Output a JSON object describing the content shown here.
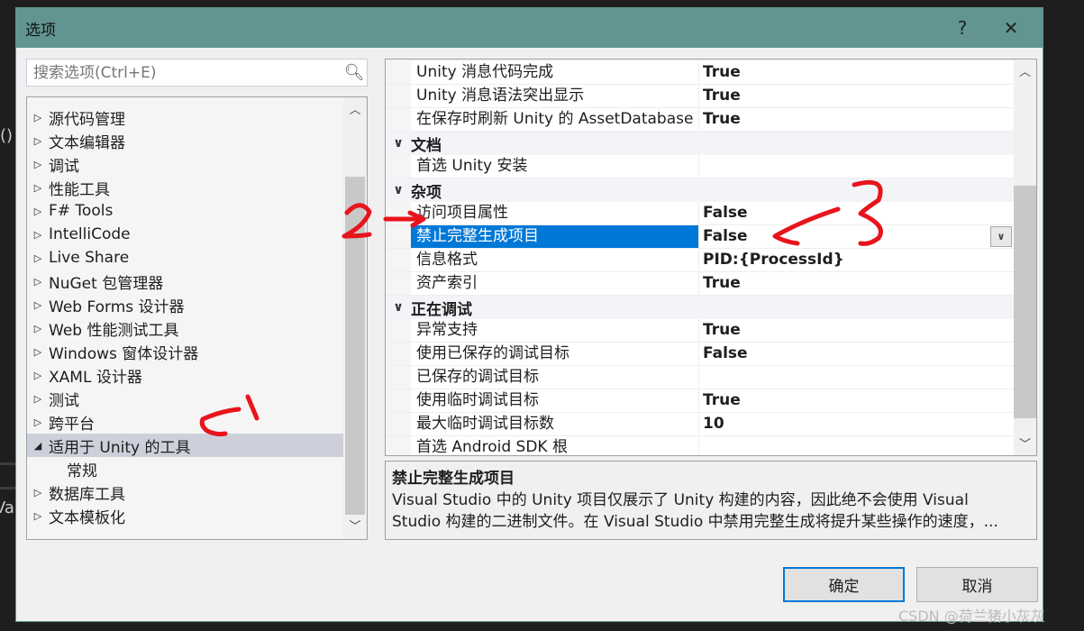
{
  "background_code": {
    "line1": "()",
    "line2": "Va"
  },
  "dialog": {
    "title": "选项",
    "help": "?",
    "close": "✕"
  },
  "search": {
    "placeholder": "搜索选项(Ctrl+E)"
  },
  "tree": {
    "items": [
      {
        "label": "源代码管理",
        "expanded": false
      },
      {
        "label": "文本编辑器",
        "expanded": false
      },
      {
        "label": "调试",
        "expanded": false
      },
      {
        "label": "性能工具",
        "expanded": false
      },
      {
        "label": "F# Tools",
        "expanded": false
      },
      {
        "label": "IntelliCode",
        "expanded": false
      },
      {
        "label": "Live Share",
        "expanded": false
      },
      {
        "label": "NuGet 包管理器",
        "expanded": false
      },
      {
        "label": "Web Forms 设计器",
        "expanded": false
      },
      {
        "label": "Web 性能测试工具",
        "expanded": false
      },
      {
        "label": "Windows 窗体设计器",
        "expanded": false
      },
      {
        "label": "XAML 设计器",
        "expanded": false
      },
      {
        "label": "测试",
        "expanded": false
      },
      {
        "label": "跨平台",
        "expanded": false
      },
      {
        "label": "适用于 Unity 的工具",
        "expanded": true,
        "selected": true
      },
      {
        "label": "常规",
        "child": true
      },
      {
        "label": "数据库工具",
        "expanded": false
      },
      {
        "label": "文本模板化",
        "expanded": false
      }
    ]
  },
  "grid": {
    "rows": [
      {
        "type": "prop",
        "name": "Unity 消息代码完成",
        "value": "True"
      },
      {
        "type": "prop",
        "name": "Unity 消息语法突出显示",
        "value": "True"
      },
      {
        "type": "prop",
        "name": "在保存时刷新 Unity 的 AssetDatabase",
        "value": "True"
      },
      {
        "type": "cat",
        "name": "文档"
      },
      {
        "type": "prop",
        "name": "首选 Unity 安装",
        "value": ""
      },
      {
        "type": "cat",
        "name": "杂项"
      },
      {
        "type": "prop",
        "name": "访问项目属性",
        "value": "False"
      },
      {
        "type": "prop",
        "name": "禁止完整生成项目",
        "value": "False",
        "selected": true
      },
      {
        "type": "prop",
        "name": "信息格式",
        "value": "PID:{ProcessId}"
      },
      {
        "type": "prop",
        "name": "资产索引",
        "value": "True"
      },
      {
        "type": "cat",
        "name": "正在调试"
      },
      {
        "type": "prop",
        "name": "异常支持",
        "value": "True"
      },
      {
        "type": "prop",
        "name": "使用已保存的调试目标",
        "value": "False"
      },
      {
        "type": "prop",
        "name": "已保存的调试目标",
        "value": ""
      },
      {
        "type": "prop",
        "name": "使用临时调试目标",
        "value": "True"
      },
      {
        "type": "prop",
        "name": "最大临时调试目标数",
        "value": "10"
      },
      {
        "type": "prop",
        "name": "首选 Android SDK 根",
        "value": ""
      }
    ]
  },
  "description": {
    "title": "禁止完整生成项目",
    "line1": "Visual Studio 中的 Unity 项目仅展示了 Unity 构建的内容，因此绝不会使用 Visual",
    "line2": "Studio 构建的二进制文件。在 Visual Studio 中禁用完整生成将提升某些操作的速度，..."
  },
  "buttons": {
    "ok": "确定",
    "cancel": "取消"
  },
  "watermark": "CSDN @荷兰猪小灰灰",
  "colors": {
    "titlebar": "#629592",
    "selection": "#0078d7",
    "tree_selection": "#cdd0db",
    "annotation": "#e8141c"
  }
}
